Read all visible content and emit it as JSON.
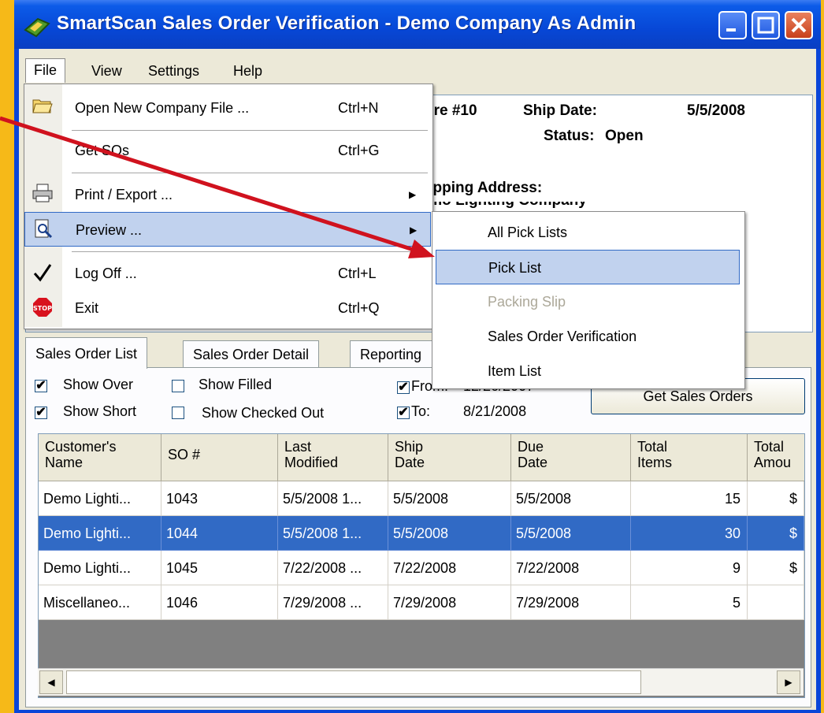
{
  "window": {
    "title": "SmartScan Sales Order Verification - Demo Company As Admin"
  },
  "menubar": [
    "File",
    "View",
    "Settings",
    "Help"
  ],
  "file_menu": [
    {
      "label": "Open New Company File ...",
      "shortcut": "Ctrl+N",
      "icon": "open-folder-icon"
    },
    {
      "label": "Get SOs",
      "shortcut": "Ctrl+G",
      "icon": ""
    },
    {
      "label": "Print / Export ...",
      "shortcut": "",
      "icon": "printer-icon",
      "submenu": true
    },
    {
      "label": "Preview ...",
      "shortcut": "",
      "icon": "preview-icon",
      "submenu": true,
      "highlighted": true
    },
    {
      "label": "Log Off ...",
      "shortcut": "Ctrl+L",
      "icon": "checkmark-icon"
    },
    {
      "label": "Exit",
      "shortcut": "Ctrl+Q",
      "icon": "stop-icon"
    }
  ],
  "stop_icon_text": "STOP",
  "preview_submenu": [
    {
      "label": "All Pick Lists",
      "enabled": true
    },
    {
      "label": "Pick List",
      "enabled": true,
      "highlighted": true
    },
    {
      "label": "Packing Slip",
      "enabled": false
    },
    {
      "label": "Sales Order Verification",
      "enabled": true
    },
    {
      "label": "Item List",
      "enabled": true
    }
  ],
  "detail": {
    "store_fragment": "Store #10",
    "ship_date_label": "Ship Date:",
    "ship_date_value": "5/5/2008",
    "status_label": "Status:",
    "status_value": "Open",
    "shipping_address_label": "Shipping Address:",
    "shipping_line1_fragment": "Demo Lighting Company"
  },
  "tabs": [
    "Sales Order List",
    "Sales Order Detail",
    "Reporting"
  ],
  "filters": {
    "show_over": {
      "label": "Show Over",
      "checked": true
    },
    "show_filled": {
      "label": "Show Filled",
      "checked": false
    },
    "show_short": {
      "label": "Show Short",
      "checked": true
    },
    "show_checked_out": {
      "label": "Show Checked Out",
      "checked": false
    },
    "from": {
      "label": "From:",
      "value": "12/26/2007",
      "checked": true
    },
    "to": {
      "label": "To:",
      "value": "8/21/2008",
      "checked": true
    },
    "get_sales_orders_label": "Get Sales Orders"
  },
  "check_glyph": "✔",
  "grid": {
    "columns": [
      {
        "line1": "Customer's",
        "line2": "Name"
      },
      {
        "line1": "SO #",
        "line2": ""
      },
      {
        "line1": "Last",
        "line2": "Modified"
      },
      {
        "line1": "Ship",
        "line2": "Date"
      },
      {
        "line1": "Due",
        "line2": "Date"
      },
      {
        "line1": "Total",
        "line2": "Items"
      },
      {
        "line1": "Total",
        "line2": "Amou"
      }
    ],
    "rows": [
      {
        "customer": "Demo Lighti...",
        "so": "1043",
        "modified": "5/5/2008 1...",
        "ship": "5/5/2008",
        "due": "5/5/2008",
        "items": "15",
        "amount": "$",
        "selected": false
      },
      {
        "customer": "Demo Lighti...",
        "so": "1044",
        "modified": "5/5/2008 1...",
        "ship": "5/5/2008",
        "due": "5/5/2008",
        "items": "30",
        "amount": "$",
        "selected": true
      },
      {
        "customer": "Demo Lighti...",
        "so": "1045",
        "modified": "7/22/2008 ...",
        "ship": "7/22/2008",
        "due": "7/22/2008",
        "items": "9",
        "amount": "$",
        "selected": false
      },
      {
        "customer": "Miscellaneo...",
        "so": "1046",
        "modified": "7/29/2008 ...",
        "ship": "7/29/2008",
        "due": "7/29/2008",
        "items": "5",
        "amount": "",
        "selected": false
      }
    ]
  },
  "colors": {
    "background": "#f6b918",
    "titlebar": "#0a46d8",
    "selection": "#316ac5",
    "menu_highlight": "#c1d2ee",
    "arrow": "#d0121e"
  }
}
